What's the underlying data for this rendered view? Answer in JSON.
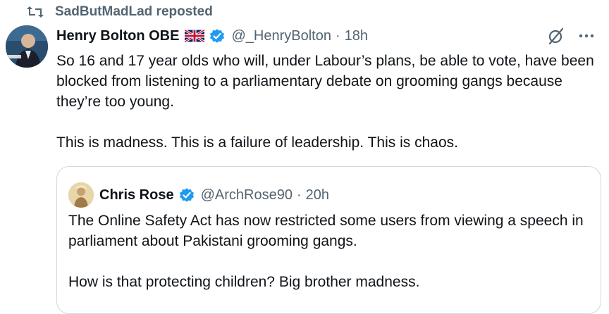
{
  "repost": {
    "icon": "repost-icon",
    "text": "SadButMadLad reposted"
  },
  "tweet": {
    "author_name": "Henry Bolton OBE",
    "flag_icon": "uk-flag-icon",
    "verified_icon": "verified-badge-icon",
    "handle": "@_HenryBolton",
    "separator": "·",
    "time": "18h",
    "paragraphs": [
      "So 16 and 17 year olds who will, under Labour’s plans, be able to vote, have been blocked from listening to a parliamentary debate on grooming gangs because they’re too young.",
      "This is madness. This is a failure of leadership. This is chaos."
    ]
  },
  "quote": {
    "author_name": "Chris Rose",
    "verified_icon": "verified-badge-icon",
    "handle": "@ArchRose90",
    "separator": "·",
    "time": "20h",
    "paragraphs": [
      "The Online Safety Act has now restricted some users from viewing a speech in parliament about Pakistani grooming gangs.",
      "How is that protecting children? Big brother madness."
    ]
  },
  "colors": {
    "text": "#0f1419",
    "secondary": "#536471",
    "verified": "#1d9bf0",
    "border": "#cfd9de"
  }
}
